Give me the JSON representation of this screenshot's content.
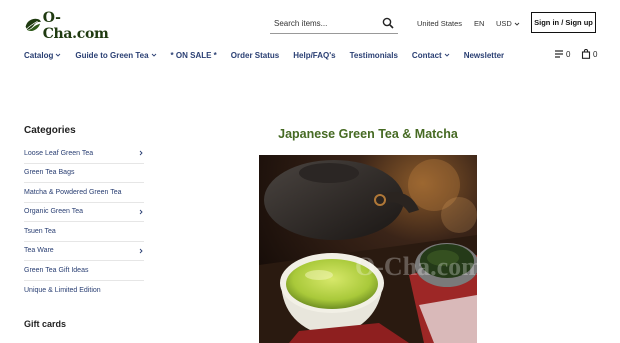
{
  "header": {
    "logo_text": "O-Cha.com",
    "search_placeholder": "Search items...",
    "country": "United States",
    "language": "EN",
    "currency": "USD",
    "signin_label": "Sign in / Sign up"
  },
  "nav": {
    "items": [
      {
        "label": "Catalog",
        "has_dropdown": true
      },
      {
        "label": "Guide to Green Tea",
        "has_dropdown": true
      },
      {
        "label": "* ON SALE *",
        "has_dropdown": false
      },
      {
        "label": "Order Status",
        "has_dropdown": false
      },
      {
        "label": "Help/FAQ's",
        "has_dropdown": false
      },
      {
        "label": "Testimonials",
        "has_dropdown": false
      },
      {
        "label": "Contact",
        "has_dropdown": true
      },
      {
        "label": "Newsletter",
        "has_dropdown": false
      }
    ],
    "compare_count": "0",
    "cart_count": "0"
  },
  "sidebar": {
    "heading": "Categories",
    "items": [
      {
        "label": "Loose Leaf Green Tea",
        "has_children": true
      },
      {
        "label": "Green Tea Bags",
        "has_children": false
      },
      {
        "label": "Matcha & Powdered Green Tea",
        "has_children": false
      },
      {
        "label": "Organic Green Tea",
        "has_children": true
      },
      {
        "label": "Tsuen Tea",
        "has_children": false
      },
      {
        "label": "Tea Ware",
        "has_children": true
      },
      {
        "label": "Green Tea Gift Ideas",
        "has_children": false
      },
      {
        "label": "Unique & Limited Edition",
        "has_children": false
      }
    ],
    "gift_heading": "Gift cards"
  },
  "main": {
    "title": "Japanese Green Tea & Matcha",
    "watermark": "O-Cha.com"
  },
  "colors": {
    "nav_link": "#2a3f73",
    "title_green": "#466a23",
    "logo_green": "#1f3a10"
  }
}
